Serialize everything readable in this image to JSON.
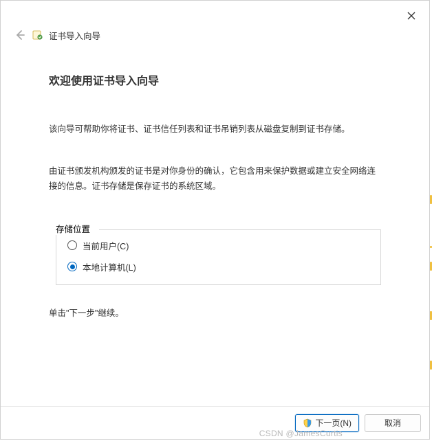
{
  "window": {
    "wizard_title": "证书导入向导"
  },
  "content": {
    "heading": "欢迎使用证书导入向导",
    "para1": "该向导可帮助你将证书、证书信任列表和证书吊销列表从磁盘复制到证书存储。",
    "para2": "由证书颁发机构颁发的证书是对你身份的确认，它包含用来保护数据或建立安全网络连接的信息。证书存储是保存证书的系统区域。",
    "storage_group_label": "存储位置",
    "radio_current_user": "当前用户(C)",
    "radio_local_machine": "本地计算机(L)",
    "continue_hint": "单击\"下一步\"继续。"
  },
  "footer": {
    "next_label": "下一页(N)",
    "cancel_label": "取消"
  },
  "watermark": "CSDN @JamesCurtis"
}
